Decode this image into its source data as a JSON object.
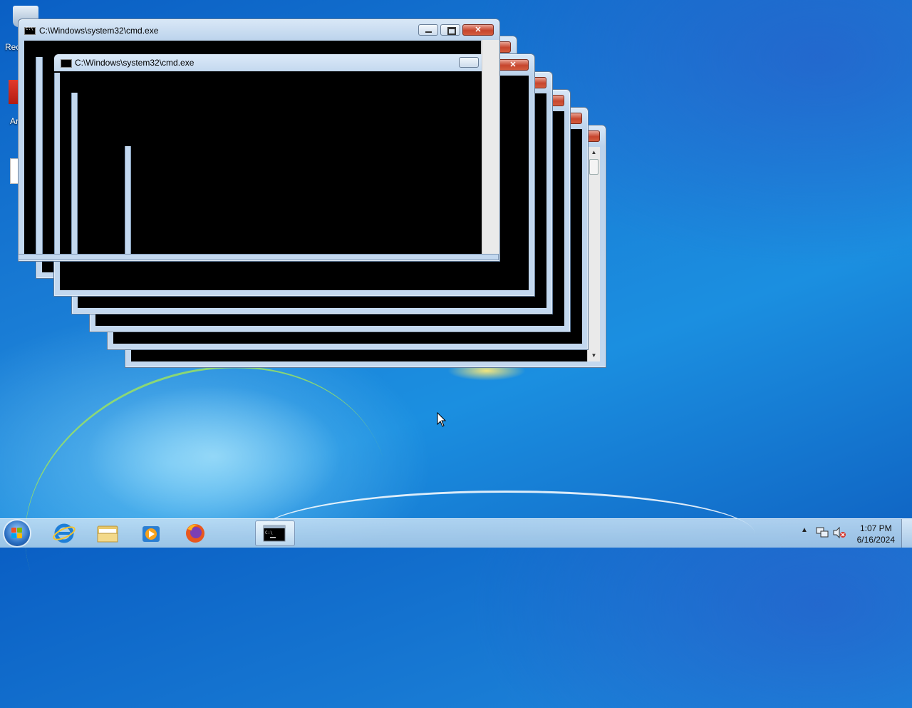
{
  "desktop": {
    "icons": [
      {
        "label": "Rec",
        "icon": "recycle-bin-icon"
      },
      {
        "label": "Ar",
        "icon": "acrobat-reader-icon"
      }
    ]
  },
  "windows": [
    {
      "title": "C:\\Windows\\system32\\cmd.exe"
    },
    {
      "title": "C:\\Windows\\system32\\cmd.exe"
    }
  ],
  "taskbar": {
    "start_icon": "windows-start-icon",
    "pinned": [
      {
        "name": "Internet Explorer",
        "icon": "internet-explorer-icon"
      },
      {
        "name": "Windows Explorer",
        "icon": "folder-icon"
      },
      {
        "name": "Windows Media Player",
        "icon": "media-player-icon"
      },
      {
        "name": "Firefox",
        "icon": "firefox-icon"
      },
      {
        "name": "Command Prompt",
        "icon": "cmd-icon",
        "active": true
      }
    ],
    "tray_icons": [
      "show-hidden-icons-chevron",
      "network-icon",
      "volume-muted-icon"
    ],
    "clock_time": "1:07 PM",
    "clock_date": "6/16/2024"
  },
  "colors": {
    "desktop_blue": "#1a7ed6",
    "console_black": "#000000",
    "close_red": "#c7452d"
  }
}
